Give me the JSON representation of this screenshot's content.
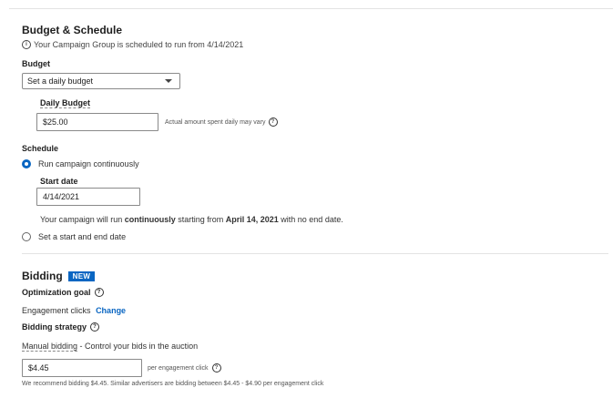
{
  "budget_schedule": {
    "title": "Budget & Schedule",
    "info_icon": "info-icon",
    "info_text": "Your Campaign Group is scheduled to run from 4/14/2021",
    "budget_label": "Budget",
    "budget_select_value": "Set a daily budget",
    "daily_budget_label": "Daily Budget",
    "daily_budget_value": "$25.00",
    "daily_budget_note": "Actual amount spent daily may vary"
  },
  "schedule": {
    "label": "Schedule",
    "option_continuous": "Run campaign continuously",
    "start_date_label": "Start date",
    "start_date_value": "4/14/2021",
    "desc_prefix": "Your campaign will run ",
    "desc_bold1": "continuously",
    "desc_mid": " starting from ",
    "desc_bold2": "April 14, 2021",
    "desc_suffix": " with no end date.",
    "option_start_end": "Set a start and end date"
  },
  "bidding": {
    "title": "Bidding",
    "badge": "NEW",
    "optimization_goal_label": "Optimization goal",
    "optimization_goal_value": "Engagement clicks",
    "change_link": "Change",
    "strategy_label": "Bidding strategy",
    "strategy_name": "Manual bidding",
    "strategy_desc": " - Control your bids in the auction",
    "bid_value": "$4.45",
    "bid_unit": "per engagement click",
    "recommendation": "We recommend bidding $4.45. Similar advertisers are bidding between $4.45 - $4.90 per engagement click"
  },
  "colors": {
    "accent": "#0a66c2",
    "text": "#1f1f1f",
    "border": "#8a8a8a"
  }
}
